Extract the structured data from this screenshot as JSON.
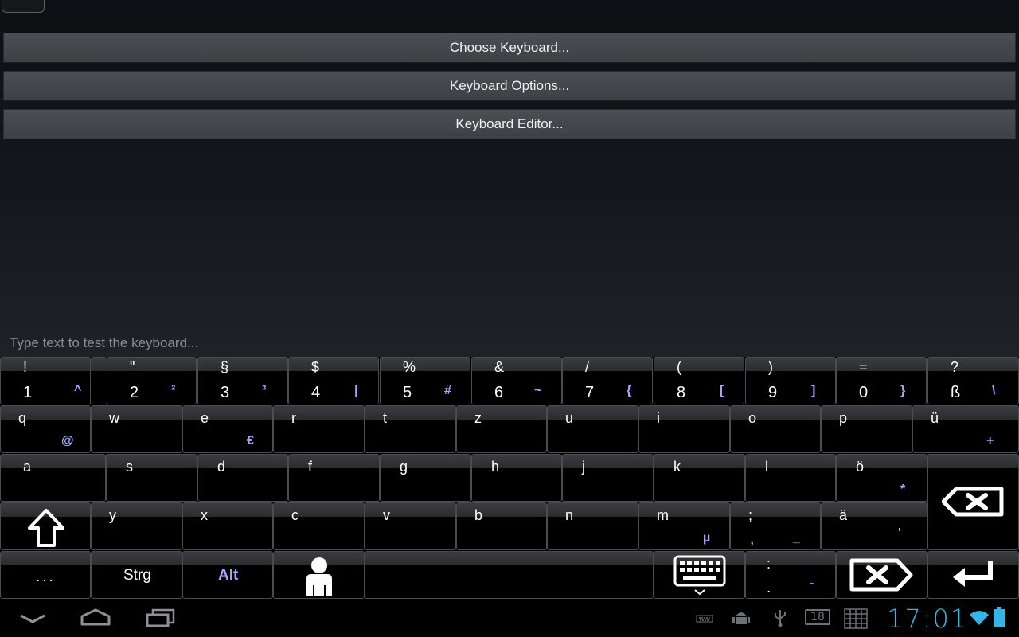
{
  "menu": {
    "choose_keyboard": "Choose Keyboard...",
    "keyboard_options": "Keyboard Options...",
    "keyboard_editor": "Keyboard Editor..."
  },
  "test_input": {
    "placeholder": "Type text to test the keyboard...",
    "value": ""
  },
  "keyboard": {
    "number_row": [
      {
        "top": "!",
        "main": "1",
        "alt": "^"
      },
      {
        "top": "\"",
        "main": "2",
        "alt": "²"
      },
      {
        "top": "§",
        "main": "3",
        "alt": "³"
      },
      {
        "top": "$",
        "main": "4",
        "alt": "|"
      },
      {
        "top": "%",
        "main": "5",
        "alt": "#"
      },
      {
        "top": "&",
        "main": "6",
        "alt": "~"
      },
      {
        "top": "/",
        "main": "7",
        "alt": "{"
      },
      {
        "top": "(",
        "main": "8",
        "alt": "["
      },
      {
        "top": ")",
        "main": "9",
        "alt": "]"
      },
      {
        "top": "=",
        "main": "0",
        "alt": "}"
      },
      {
        "top": "?",
        "main": "ß",
        "alt": "\\"
      }
    ],
    "row_q": [
      {
        "main": "q",
        "alt": "@"
      },
      {
        "main": "w",
        "alt": ""
      },
      {
        "main": "e",
        "alt": "€"
      },
      {
        "main": "r",
        "alt": ""
      },
      {
        "main": "t",
        "alt": ""
      },
      {
        "main": "z",
        "alt": ""
      },
      {
        "main": "u",
        "alt": ""
      },
      {
        "main": "i",
        "alt": ""
      },
      {
        "main": "o",
        "alt": ""
      },
      {
        "main": "p",
        "alt": ""
      },
      {
        "main": "ü",
        "alt": "+"
      }
    ],
    "row_a": [
      {
        "main": "a",
        "alt": ""
      },
      {
        "main": "s",
        "alt": ""
      },
      {
        "main": "d",
        "alt": ""
      },
      {
        "main": "f",
        "alt": ""
      },
      {
        "main": "g",
        "alt": ""
      },
      {
        "main": "h",
        "alt": ""
      },
      {
        "main": "j",
        "alt": ""
      },
      {
        "main": "k",
        "alt": ""
      },
      {
        "main": "l",
        "alt": ""
      },
      {
        "main": "ö",
        "alt": "*"
      }
    ],
    "row_y": [
      {
        "main": "y",
        "alt": ""
      },
      {
        "main": "x",
        "alt": ""
      },
      {
        "main": "c",
        "alt": ""
      },
      {
        "main": "v",
        "alt": ""
      },
      {
        "main": "b",
        "alt": ""
      },
      {
        "main": "n",
        "alt": ""
      },
      {
        "main": "m",
        "alt": "µ"
      }
    ],
    "semicolon_key": {
      "top": ";",
      "bottom": ",",
      "alt": "_"
    },
    "ae_key": {
      "main": "ä",
      "alt": "'"
    },
    "colon_key": {
      "top": ":",
      "bottom": ".",
      "alt": "-"
    },
    "more_label": "...",
    "ctrl_label": "Strg",
    "alt_label": "Alt"
  },
  "status_bar": {
    "clock": "17:01",
    "notification_count": "18"
  },
  "colors": {
    "accent": "#33b5e5",
    "alt_char": "#a6a6ff"
  }
}
